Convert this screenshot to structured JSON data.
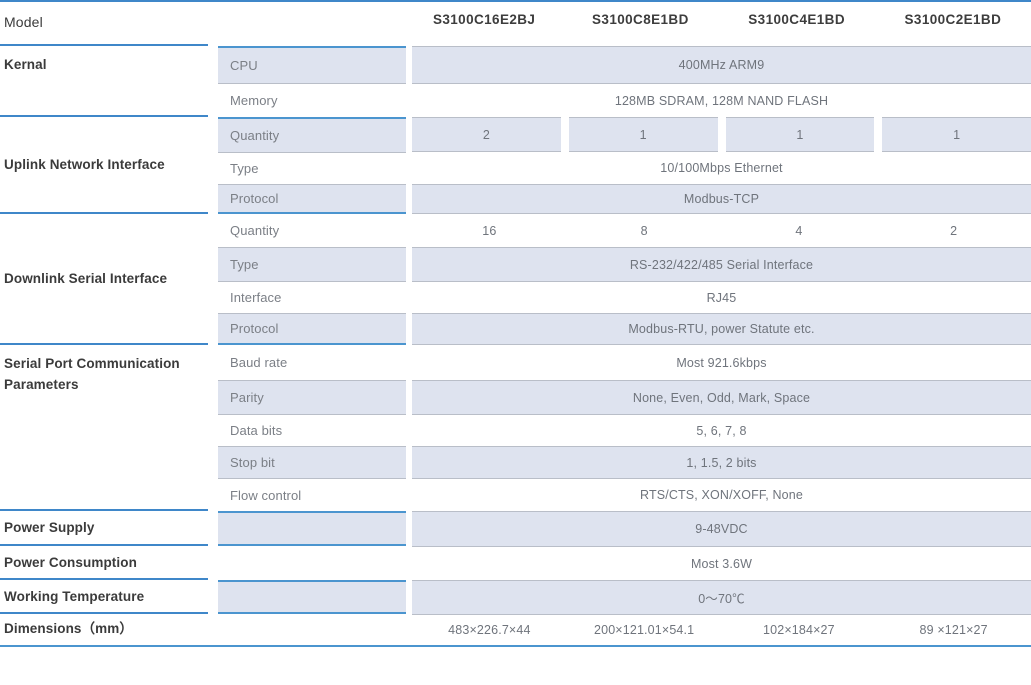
{
  "header": {
    "row_label": "Model",
    "models": [
      "S3100C16E2BJ",
      "S3100C8E1BD",
      "S3100C4E1BD",
      "S3100C2E1BD"
    ]
  },
  "groups": {
    "kernal": "Kernal",
    "uplink": "Uplink Network Interface",
    "downlink": "Downlink Serial Interface",
    "serial_params": "Serial Port Communication Parameters",
    "power_supply": "Power Supply",
    "power_consumption": "Power Consumption",
    "working_temperature": "Working Temperature",
    "dimensions": "Dimensions（mm）"
  },
  "rows": {
    "cpu": {
      "label": "CPU",
      "value": "400MHz ARM9"
    },
    "memory": {
      "label": "Memory",
      "value": "128MB SDRAM, 128M NAND FLASH"
    },
    "up_qty": {
      "label": "Quantity",
      "values": [
        "2",
        "1",
        "1",
        "1"
      ]
    },
    "up_type": {
      "label": "Type",
      "value": "10/100Mbps Ethernet"
    },
    "up_proto": {
      "label": "Protocol",
      "value": "Modbus-TCP"
    },
    "dn_qty": {
      "label": "Quantity",
      "values": [
        "16",
        "8",
        "4",
        "2"
      ]
    },
    "dn_type": {
      "label": "Type",
      "value": "RS-232/422/485 Serial Interface"
    },
    "dn_iface": {
      "label": "Interface",
      "value": "RJ45"
    },
    "dn_proto": {
      "label": "Protocol",
      "value": "Modbus-RTU, power Statute etc."
    },
    "baud": {
      "label": "Baud rate",
      "value": "Most 921.6kbps"
    },
    "parity": {
      "label": "Parity",
      "value": "None, Even, Odd, Mark, Space"
    },
    "data_bits": {
      "label": "Data bits",
      "value": "5, 6, 7, 8"
    },
    "stop_bit": {
      "label": "Stop bit",
      "value": "1, 1.5, 2 bits"
    },
    "flow": {
      "label": "Flow control",
      "value": "RTS/CTS, XON/XOFF, None"
    },
    "supply": {
      "label": "",
      "value": "9-48VDC"
    },
    "consumption": {
      "label": "",
      "value": "Most 3.6W"
    },
    "temperature": {
      "label": "",
      "value": "0～70℃"
    },
    "dims": {
      "label": "",
      "values": [
        "483×226.7×44",
        "200×121.01×54.1",
        "102×184×27",
        "89 ×121×27"
      ]
    }
  },
  "colors": {
    "accent_blue": "#4b95cf",
    "shade": "#dee3ef",
    "gray_rule": "#b9bec8",
    "label_text": "#3b3b3b",
    "value_text": "#6f747c"
  }
}
